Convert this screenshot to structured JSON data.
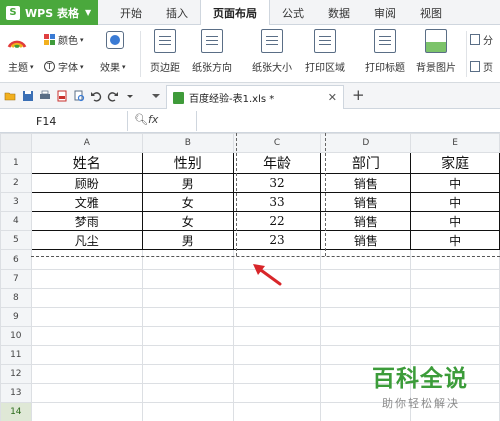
{
  "app": {
    "name": "WPS 表格",
    "logo": "S"
  },
  "menu": {
    "tabs": [
      "开始",
      "插入",
      "页面布局",
      "公式",
      "数据",
      "审阅",
      "视图"
    ],
    "active_index": 2
  },
  "ribbon": {
    "theme_label": "主题",
    "colors_label": "颜色",
    "fonts_label": "字体",
    "effects_label": "效果",
    "margins_label": "页边距",
    "orientation_label": "纸张方向",
    "size_label": "纸张大小",
    "print_area_label": "打印区域",
    "print_titles_label": "打印标题",
    "background_label": "背景图片",
    "partial_label": "分",
    "partial2_label": "页"
  },
  "document_tab": {
    "name": "百度经验-表1.xls *"
  },
  "formula_bar": {
    "cell_ref": "F14",
    "fx_label": "fx",
    "value": ""
  },
  "grid": {
    "columns": [
      "A",
      "B",
      "C",
      "D",
      "E"
    ],
    "rows": [
      "1",
      "2",
      "3",
      "4",
      "5",
      "6",
      "7",
      "8",
      "9",
      "10",
      "11",
      "12",
      "13",
      "14"
    ],
    "selected_row": "14",
    "header": [
      "姓名",
      "性别",
      "年龄",
      "部门",
      "家庭"
    ],
    "data": [
      [
        "顾盼",
        "男",
        "32",
        "销售",
        "中"
      ],
      [
        "文雅",
        "女",
        "33",
        "销售",
        "中"
      ],
      [
        "梦雨",
        "女",
        "22",
        "销售",
        "中"
      ],
      [
        "凡尘",
        "男",
        "23",
        "销售",
        "中"
      ]
    ]
  },
  "watermark": {
    "title": "百科全说",
    "subtitle": "助你轻松解决"
  },
  "colors": {
    "accent": "#4aa83c",
    "arrow": "#d8262a",
    "watermark": "#3c9c3a"
  }
}
